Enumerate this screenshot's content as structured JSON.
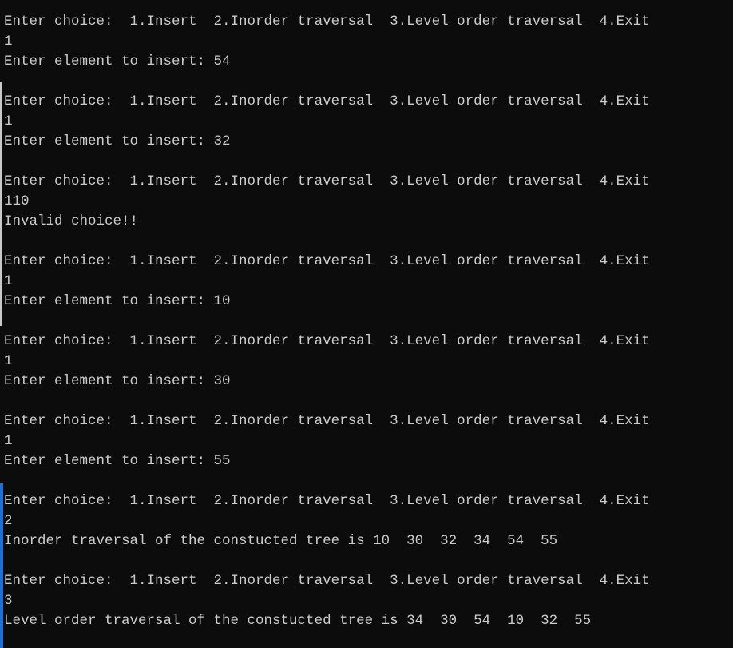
{
  "console": {
    "lines": [
      "Enter choice:  1.Insert  2.Inorder traversal  3.Level order traversal  4.Exit",
      "1",
      "Enter element to insert: 54",
      "",
      "Enter choice:  1.Insert  2.Inorder traversal  3.Level order traversal  4.Exit",
      "1",
      "Enter element to insert: 32",
      "",
      "Enter choice:  1.Insert  2.Inorder traversal  3.Level order traversal  4.Exit",
      "110",
      "Invalid choice!!",
      "",
      "Enter choice:  1.Insert  2.Inorder traversal  3.Level order traversal  4.Exit",
      "1",
      "Enter element to insert: 10",
      "",
      "Enter choice:  1.Insert  2.Inorder traversal  3.Level order traversal  4.Exit",
      "1",
      "Enter element to insert: 30",
      "",
      "Enter choice:  1.Insert  2.Inorder traversal  3.Level order traversal  4.Exit",
      "1",
      "Enter element to insert: 55",
      "",
      "Enter choice:  1.Insert  2.Inorder traversal  3.Level order traversal  4.Exit",
      "2",
      "Inorder traversal of the constucted tree is 10  30  32  34  54  55",
      "",
      "Enter choice:  1.Insert  2.Inorder traversal  3.Level order traversal  4.Exit",
      "3",
      "Level order traversal of the constucted tree is 34  30  54  10  32  55"
    ]
  },
  "colors": {
    "background": "#0c0c0c",
    "text": "#cccccc",
    "edge_accent": "#1e6fd9"
  }
}
